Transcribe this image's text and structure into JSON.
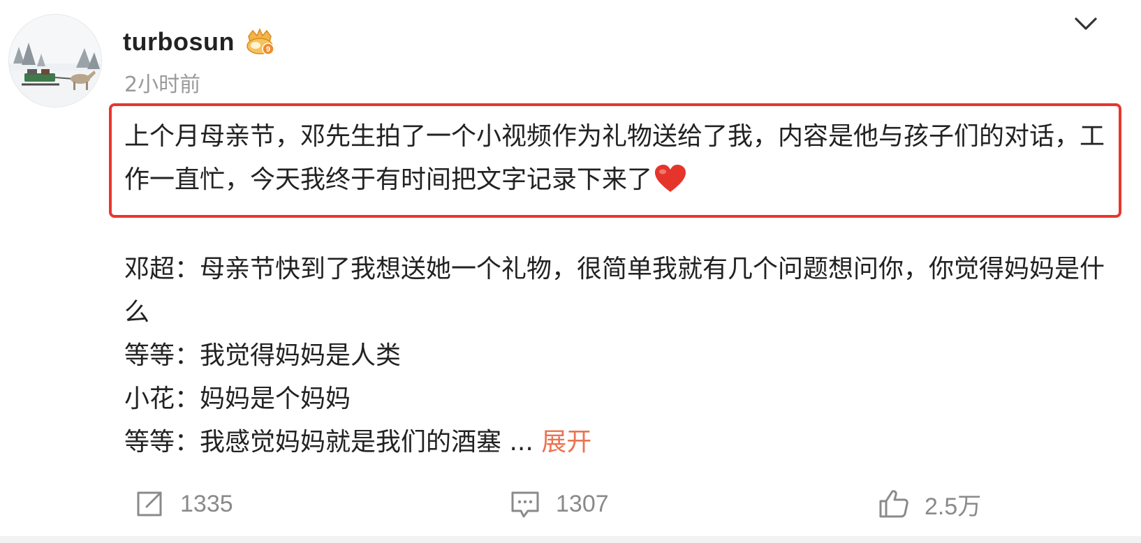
{
  "post": {
    "author": {
      "name": "turbosun",
      "avatar_icon": "snowy-sleigh-avatar",
      "badge_icon": "vip-crown-badge-icon"
    },
    "time": "2小时前",
    "menu_icon": "chevron-down-icon",
    "intro": {
      "text": "上个月母亲节，邓先生拍了一个小视频作为礼物送给了我，内容是他与孩子们的对话，工作一直忙，今天我终于有时间把文字记录下来了",
      "emoji": "heart-emoji",
      "highlight_color": "#e8362e"
    },
    "dialogue": [
      {
        "text": "邓超：母亲节快到了我想送她一个礼物，很简单我就有几个问题想问你，你觉得妈妈是什么"
      },
      {
        "text": "等等：我觉得妈妈是人类"
      },
      {
        "text": "小花：妈妈是个妈妈"
      },
      {
        "text": "等等：我感觉妈妈就是我们的酒塞"
      }
    ],
    "ellipsis": " ...",
    "expand_label": "展开",
    "expand_color": "#eb7350"
  },
  "actions": {
    "repost": {
      "icon": "share-icon",
      "count": "1335"
    },
    "comment": {
      "icon": "comment-icon",
      "count": "1307"
    },
    "like": {
      "icon": "thumbs-up-icon",
      "count": "2.5万"
    }
  }
}
